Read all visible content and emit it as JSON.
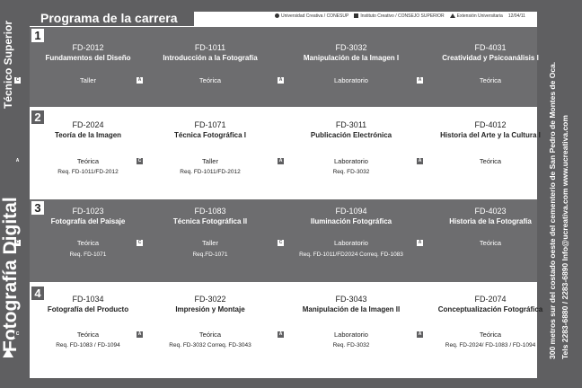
{
  "left_rail": {
    "tecnico": "Técnico Superior",
    "carrera": "Fotografía Digital"
  },
  "header": {
    "title": "Programa de la carrera"
  },
  "legend": {
    "item1": "Universidad Creativa / CONESUP",
    "item2": "Instituto Creativo / CONSEJO SUPERIOR",
    "item3": "Extensión Universitaria",
    "date": "12/04/11"
  },
  "rows": [
    {
      "num": "1",
      "courses": [
        {
          "code": "FD-2012",
          "name": "Fundamentos del Diseño",
          "box": "C",
          "type": "Taller",
          "req": ""
        },
        {
          "code": "FD-1011",
          "name": "Introducción a la Fotografía",
          "box": "A",
          "type": "Teórica",
          "req": ""
        },
        {
          "code": "FD-3032",
          "name": "Manipulación de la Imagen I",
          "box": "A",
          "type": "Laboratorio",
          "req": ""
        },
        {
          "code": "FD-4031",
          "name": "Creatividad y Psicoanálisis I",
          "box": "A",
          "type": "Teórica",
          "req": ""
        }
      ]
    },
    {
      "num": "2",
      "courses": [
        {
          "code": "FD-2024",
          "name": "Teoría de la Imagen",
          "box": "A",
          "type": "Teórica",
          "req": "Req. FD-1011/FD-2012"
        },
        {
          "code": "FD-1071",
          "name": "Técnica Fotográfica I",
          "box": "C",
          "type": "Taller",
          "req": "Req. FD-1011/FD-2012"
        },
        {
          "code": "FD-3011",
          "name": "Publicación Electrónica",
          "box": "A",
          "type": "Laboratorio",
          "req": "Req. FD-3032"
        },
        {
          "code": "FD-4012",
          "name": "Historia del Arte y la Cultura I",
          "box": "A",
          "type": "Teórica",
          "req": ""
        }
      ]
    },
    {
      "num": "3",
      "courses": [
        {
          "code": "FD-1023",
          "name": "Fotografía del Paisaje",
          "box": "C",
          "type": "Teórica",
          "req": "Req. FD-1071"
        },
        {
          "code": "FD-1083",
          "name": "Técnica Fotográfica II",
          "box": "C",
          "type": "Taller",
          "req": "Req.FD-1071"
        },
        {
          "code": "FD-1094",
          "name": "Iluminación Fotográfica",
          "box": "C",
          "type": "Laboratorio",
          "req": "Req. FD-1011/FD2024 Correq. FD-1083"
        },
        {
          "code": "FD-4023",
          "name": "Historia de la Fotografía",
          "box": "A",
          "type": "Teórica",
          "req": ""
        }
      ]
    },
    {
      "num": "4",
      "courses": [
        {
          "code": "FD-1034",
          "name": "Fotografía del Producto",
          "box": "C",
          "type": "Teórica",
          "req": "Req. FD-1083 / FD-1094"
        },
        {
          "code": "FD-3022",
          "name": "Impresión y Montaje",
          "box": "A",
          "type": "Teórica",
          "req": "Req. FD-3032 Correq. FD-3043"
        },
        {
          "code": "FD-3043",
          "name": "Manipulación de la Imagen II",
          "box": "A",
          "type": "Laboratorio",
          "req": "Req. FD-3032"
        },
        {
          "code": "FD-2074",
          "name": "Conceptualización Fotográfica",
          "box": "A",
          "type": "Teórica",
          "req": "Req. FD-2024/ FD-1083 / FD-1094"
        }
      ]
    }
  ],
  "right_rail": {
    "line1": "300 metros sur del costado oeste del cementerio de San Pedro de Montes de Oca.",
    "line2": "Tels 2283-6880 / 2283-6890   Info@ucreativa.com   www.ucreativa.com"
  }
}
